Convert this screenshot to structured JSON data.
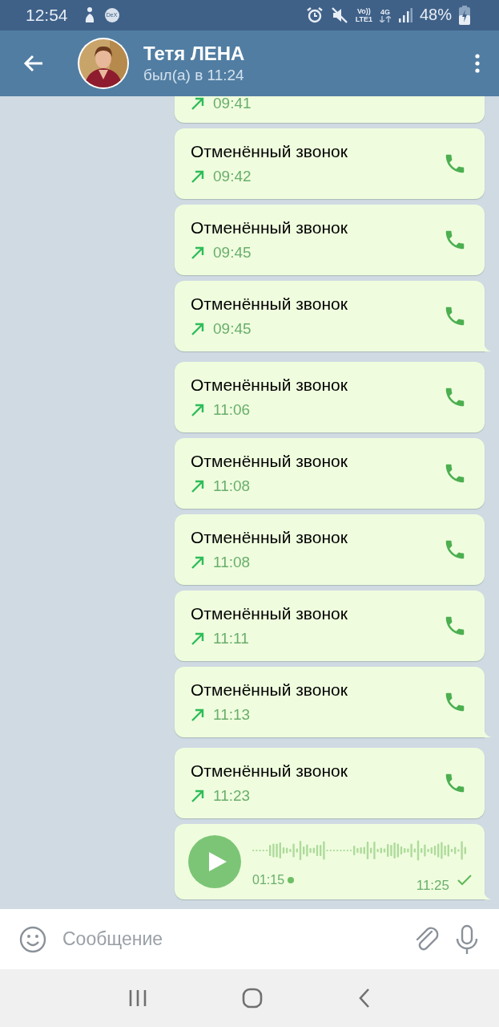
{
  "status_bar": {
    "time": "12:54",
    "dex": "DeX",
    "volte": "Vo))",
    "lte": "LTE1",
    "network": "4G",
    "battery": "48%"
  },
  "header": {
    "name": "Тетя ЛЕНА",
    "last_seen": "был(а) в 11:24"
  },
  "messages": [
    {
      "kind": "call",
      "time": "09:41",
      "tail": false
    },
    {
      "kind": "call",
      "title": "Отменённый звонок",
      "time": "09:42",
      "tail": false
    },
    {
      "kind": "call",
      "title": "Отменённый звонок",
      "time": "09:45",
      "tail": false
    },
    {
      "kind": "call",
      "title": "Отменённый звонок",
      "time": "09:45",
      "tail": true
    },
    {
      "kind": "call",
      "title": "Отменённый звонок",
      "time": "11:06",
      "tail": false
    },
    {
      "kind": "call",
      "title": "Отменённый звонок",
      "time": "11:08",
      "tail": false
    },
    {
      "kind": "call",
      "title": "Отменённый звонок",
      "time": "11:08",
      "tail": false
    },
    {
      "kind": "call",
      "title": "Отменённый звонок",
      "time": "11:11",
      "tail": false
    },
    {
      "kind": "call",
      "title": "Отменённый звонок",
      "time": "11:13",
      "tail": true
    },
    {
      "kind": "call",
      "title": "Отменённый звонок",
      "time": "11:23",
      "tail": false
    },
    {
      "kind": "voice",
      "duration": "01:15",
      "unplayed": true,
      "time": "11:25",
      "tail": true
    }
  ],
  "composer": {
    "placeholder": "Сообщение"
  }
}
